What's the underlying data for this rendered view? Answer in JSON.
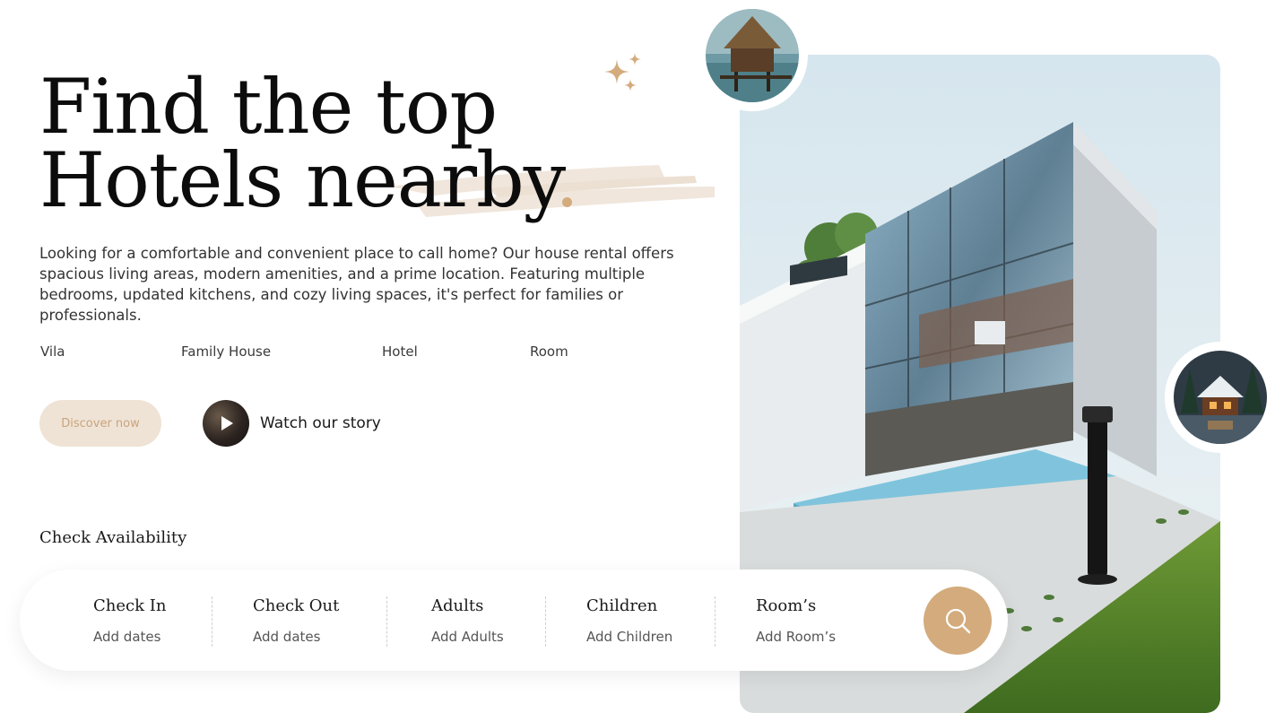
{
  "hero": {
    "title_line1": "Find the top",
    "title_line2": "Hotels nearby",
    "description": "Looking for a comfortable and convenient place to call home? Our house rental offers spacious living areas, modern amenities, and a prime location. Featuring multiple bedrooms, updated kitchens, and cozy living spaces, it's perfect for families or professionals."
  },
  "categories": [
    "Vila",
    "Family House",
    "Hotel",
    "Room"
  ],
  "actions": {
    "discover_label": "Discover now",
    "watch_label": "Watch our story"
  },
  "availability": {
    "title": "Check Availability",
    "fields": [
      {
        "label": "Check In",
        "placeholder": "Add dates"
      },
      {
        "label": "Check Out",
        "placeholder": "Add dates"
      },
      {
        "label": "Adults",
        "placeholder": "Add Adults"
      },
      {
        "label": "Children",
        "placeholder": "Add Children"
      },
      {
        "label": "Room’s",
        "placeholder": "Add Room’s"
      }
    ]
  },
  "icons": {
    "sparkle": "sparkle-icon",
    "play": "play-icon",
    "search": "search-icon"
  },
  "colors": {
    "accent": "#d3ab7d",
    "accent_light": "#efe3d6",
    "accent_text": "#c9a47c",
    "heading": "#0c0c0c"
  }
}
